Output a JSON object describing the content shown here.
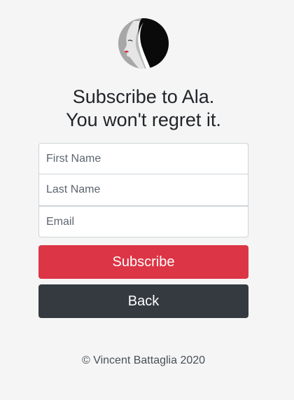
{
  "logo": {
    "icon": "woman-profile-logo-icon"
  },
  "heading": {
    "line1": "Subscribe to Ala.",
    "line2": "You won't regret it."
  },
  "form": {
    "first_name": {
      "placeholder": "First Name",
      "value": ""
    },
    "last_name": {
      "placeholder": "Last Name",
      "value": ""
    },
    "email": {
      "placeholder": "Email",
      "value": ""
    }
  },
  "buttons": {
    "subscribe_label": "Subscribe",
    "back_label": "Back"
  },
  "footer": {
    "copyright": "© Vincent Battaglia 2020"
  },
  "colors": {
    "background": "#f5f5f5",
    "subscribe": "#dc3545",
    "back": "#343a40",
    "text": "#212529"
  }
}
